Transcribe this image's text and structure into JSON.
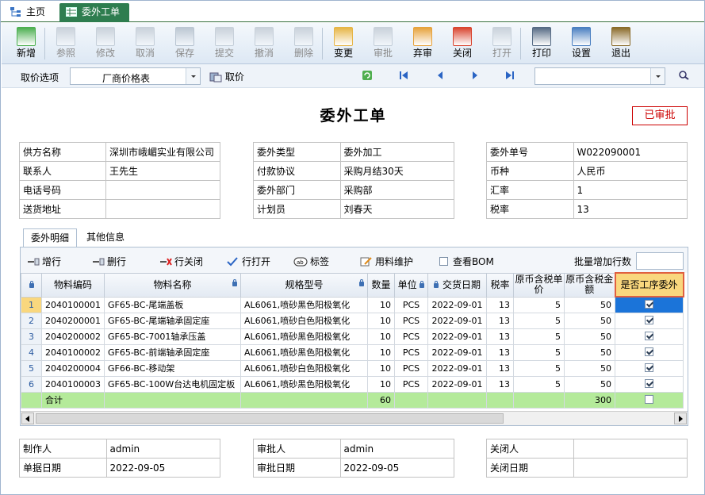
{
  "tabs": [
    {
      "label": "主页"
    },
    {
      "label": "委外工单"
    }
  ],
  "toolbar": [
    {
      "label": "新增",
      "icon": "add-icon",
      "enabled": true
    },
    {
      "label": "参照",
      "icon": "reference-icon",
      "enabled": false
    },
    {
      "label": "修改",
      "icon": "edit-icon",
      "enabled": false
    },
    {
      "label": "取消",
      "icon": "undo-icon",
      "enabled": false
    },
    {
      "label": "保存",
      "icon": "save-icon",
      "enabled": false
    },
    {
      "label": "提交",
      "icon": "submit-icon",
      "enabled": false
    },
    {
      "label": "撤消",
      "icon": "revoke-icon",
      "enabled": false
    },
    {
      "label": "删除",
      "icon": "delete-icon",
      "enabled": false
    },
    {
      "label": "变更",
      "icon": "change-icon",
      "enabled": true
    },
    {
      "label": "审批",
      "icon": "approve-icon",
      "enabled": false
    },
    {
      "label": "弃审",
      "icon": "unapprove-icon",
      "enabled": true
    },
    {
      "label": "关闭",
      "icon": "close-doc-icon",
      "enabled": true
    },
    {
      "label": "打开",
      "icon": "open-doc-icon",
      "enabled": false
    },
    {
      "label": "打印",
      "icon": "print-icon",
      "enabled": true
    },
    {
      "label": "设置",
      "icon": "settings-icon",
      "enabled": true
    },
    {
      "label": "退出",
      "icon": "exit-icon",
      "enabled": true
    }
  ],
  "filter": {
    "label": "取价选项",
    "price_option": "厂商价格表",
    "fetch_price_label": "取价",
    "search_value": ""
  },
  "doc": {
    "title": "委外工单",
    "status": "已审批"
  },
  "header_left": [
    {
      "label": "供方名称",
      "value": "深圳市峨嵋实业有限公司"
    },
    {
      "label": "联系人",
      "value": "王先生"
    },
    {
      "label": "电话号码",
      "value": ""
    },
    {
      "label": "送货地址",
      "value": ""
    }
  ],
  "header_mid": [
    {
      "label": "委外类型",
      "value": "委外加工"
    },
    {
      "label": "付款协议",
      "value": "采购月结30天"
    },
    {
      "label": "委外部门",
      "value": "采购部"
    },
    {
      "label": "计划员",
      "value": "刘春天"
    }
  ],
  "header_right": [
    {
      "label": "委外单号",
      "value": "W022090001"
    },
    {
      "label": "币种",
      "value": "人民币"
    },
    {
      "label": "汇率",
      "value": "1"
    },
    {
      "label": "税率",
      "value": "13"
    }
  ],
  "subtabs": [
    "委外明细",
    "其他信息"
  ],
  "grid_toolbar": {
    "add_row": "增行",
    "delete_row": "删行",
    "close_row": "行关闭",
    "open_row": "行打开",
    "tag": "标签",
    "material_maint": "用料维护",
    "view_bom": "查看BOM",
    "batch_add": "批量增加行数",
    "batch_value": ""
  },
  "columns": [
    "物料编码",
    "物料名称",
    "规格型号",
    "数量",
    "单位",
    "交货日期",
    "税率",
    "原币含税单价",
    "原币含税金额",
    "是否工序委外"
  ],
  "rows": [
    {
      "n": "1",
      "code": "2040100001",
      "name": "GF65-BC-尾端盖板",
      "spec": "AL6061,喷砂黑色阳极氧化",
      "qty": "10",
      "unit": "PCS",
      "date": "2022-09-01",
      "tax": "13",
      "price": "5",
      "amount": "50",
      "outsource": true
    },
    {
      "n": "2",
      "code": "2040200001",
      "name": "GF65-BC-尾端轴承固定座",
      "spec": "AL6061,喷砂白色阳极氧化",
      "qty": "10",
      "unit": "PCS",
      "date": "2022-09-01",
      "tax": "13",
      "price": "5",
      "amount": "50",
      "outsource": true
    },
    {
      "n": "3",
      "code": "2040200002",
      "name": "GF65-BC-7001轴承压盖",
      "spec": "AL6061,喷砂黑色阳极氧化",
      "qty": "10",
      "unit": "PCS",
      "date": "2022-09-01",
      "tax": "13",
      "price": "5",
      "amount": "50",
      "outsource": true
    },
    {
      "n": "4",
      "code": "2040100002",
      "name": "GF65-BC-前端轴承固定座",
      "spec": "AL6061,喷砂黑色阳极氧化",
      "qty": "10",
      "unit": "PCS",
      "date": "2022-09-01",
      "tax": "13",
      "price": "5",
      "amount": "50",
      "outsource": true
    },
    {
      "n": "5",
      "code": "2040200004",
      "name": "GF66-BC-移动架",
      "spec": "AL6061,喷砂白色阳极氧化",
      "qty": "10",
      "unit": "PCS",
      "date": "2022-09-01",
      "tax": "13",
      "price": "5",
      "amount": "50",
      "outsource": true
    },
    {
      "n": "6",
      "code": "2040100003",
      "name": "GF65-BC-100W台达电机固定板",
      "spec": "AL6061,喷砂黑色阳极氧化",
      "qty": "10",
      "unit": "PCS",
      "date": "2022-09-01",
      "tax": "13",
      "price": "5",
      "amount": "50",
      "outsource": true
    }
  ],
  "total": {
    "label": "合计",
    "qty": "60",
    "amount": "300"
  },
  "footer_left": [
    {
      "label": "制作人",
      "value": "admin"
    },
    {
      "label": "单据日期",
      "value": "2022-09-05"
    }
  ],
  "footer_mid": [
    {
      "label": "审批人",
      "value": "admin"
    },
    {
      "label": "审批日期",
      "value": "2022-09-05"
    }
  ],
  "footer_right": [
    {
      "label": "关闭人",
      "value": ""
    },
    {
      "label": "关闭日期",
      "value": ""
    }
  ]
}
